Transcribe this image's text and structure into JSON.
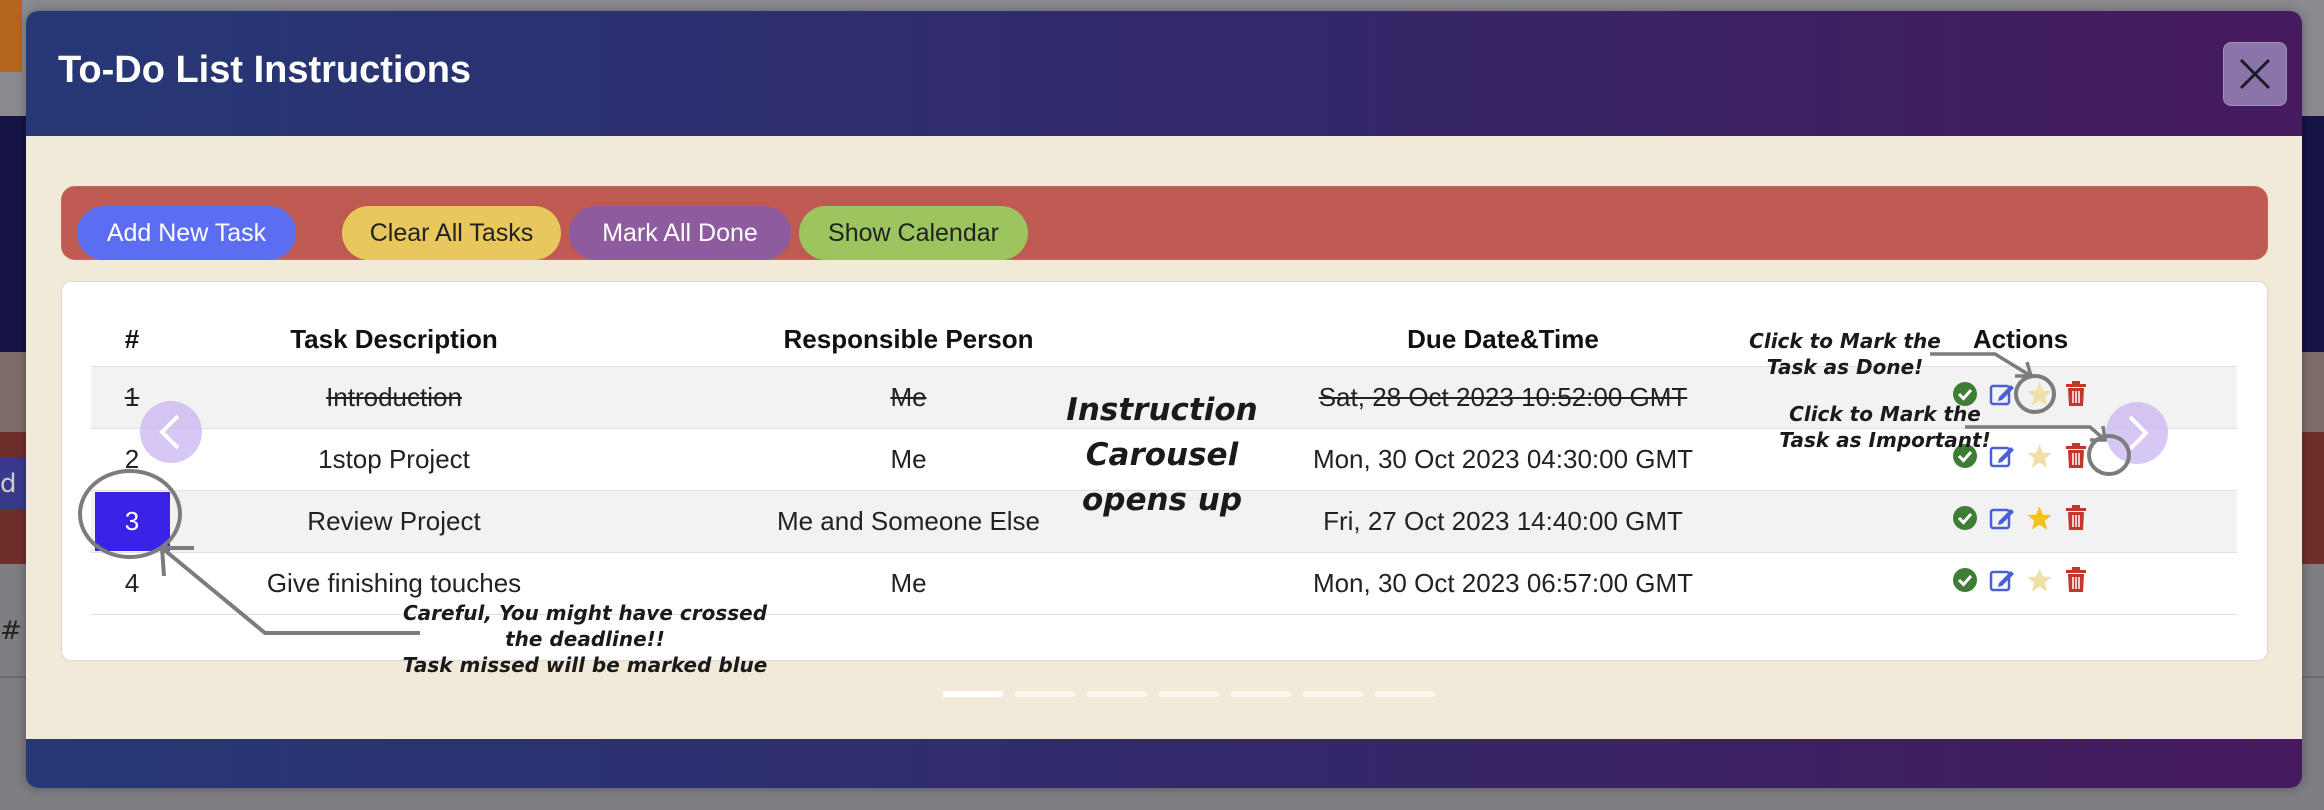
{
  "modal": {
    "title": "To-Do List Instructions"
  },
  "toolbar": {
    "add_label": "Add New Task",
    "clear_label": "Clear All Tasks",
    "done_label": "Mark All Done",
    "calendar_label": "Show Calendar"
  },
  "table": {
    "headers": [
      "#",
      "Task Description",
      "Responsible Person",
      "Due Date&Time",
      "Actions"
    ],
    "rows": [
      {
        "num": "1",
        "desc": "Introduction",
        "person": "Me",
        "due": "Sat, 28 Oct 2023 10:52:00 GMT"
      },
      {
        "num": "2",
        "desc": "1stop Project",
        "person": "Me",
        "due": "Mon, 30 Oct 2023 04:30:00 GMT"
      },
      {
        "num": "3",
        "desc": "Review Project",
        "person": "Me and Someone Else",
        "due": "Fri, 27 Oct 2023 14:40:00 GMT"
      },
      {
        "num": "4",
        "desc": "Give finishing touches",
        "person": "Me",
        "due": "Mon, 30 Oct 2023 06:57:00 GMT"
      }
    ]
  },
  "annotations": {
    "main_line1": "Instruction Carousel",
    "main_line2": "opens up",
    "done_line1": "Click to Mark the",
    "done_line2": "Task as Done!",
    "important_line1": "Click to Mark the",
    "important_line2": "Task as Important!",
    "careful_line1": "Careful, You might have crossed",
    "careful_line2": "the deadline!!",
    "careful_line3": "Task missed will be marked blue"
  },
  "background": {
    "left_button_text": "d N",
    "hash_text": "#"
  },
  "colors": {
    "header_start": "#263876",
    "header_end": "#461a5e",
    "toolbar_bg": "#bf5a52",
    "add_btn": "#5b6ef2",
    "clear_btn": "#e8c75c",
    "done_btn": "#8e5c9e",
    "calendar_btn": "#9cc55f",
    "missed_task": "#3b22e8"
  },
  "icons": [
    "close-icon",
    "check-circle-icon",
    "edit-icon",
    "star-icon",
    "trash-icon",
    "chevron-left-icon",
    "chevron-right-icon"
  ],
  "carousel": {
    "slide_count": 7,
    "active_slide": 1
  }
}
